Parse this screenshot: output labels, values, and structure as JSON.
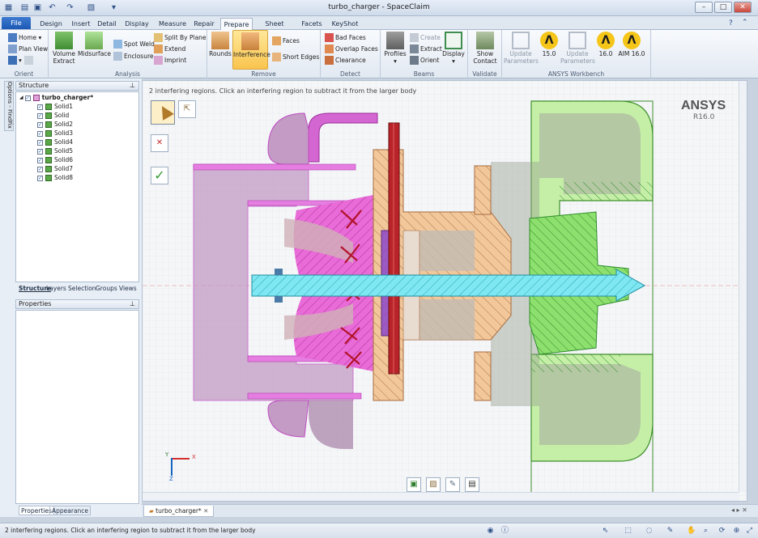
{
  "window": {
    "title": "turbo_charger - SpaceClaim"
  },
  "ribbon_tabs": [
    "File",
    "Design",
    "Insert",
    "Detail",
    "Display",
    "Measure",
    "Repair",
    "Prepare",
    "Sheet Metal",
    "Facets",
    "KeyShot"
  ],
  "active_tab": "Prepare",
  "groups": {
    "orient": {
      "label": "Orient",
      "home": "Home",
      "plan_view": "Plan View"
    },
    "analysis": {
      "label": "Analysis",
      "volume_extract": "Volume Extract",
      "midsurface": "Midsurface",
      "spot_weld": "Spot Weld",
      "enclosure": "Enclosure",
      "split_by_plane": "Split By Plane",
      "extend": "Extend",
      "imprint": "Imprint"
    },
    "remove": {
      "label": "Remove",
      "rounds": "Rounds",
      "interference": "Interference",
      "faces": "Faces",
      "short_edges": "Short Edges"
    },
    "detect": {
      "label": "Detect",
      "bad_faces": "Bad Faces",
      "overlap_faces": "Overlap Faces",
      "clearance": "Clearance"
    },
    "beams": {
      "label": "Beams",
      "profiles": "Profiles",
      "create": "Create",
      "extract": "Extract",
      "orient": "Orient",
      "display": "Display"
    },
    "validate": {
      "label": "Validate",
      "show_contact": "Show Contact"
    },
    "ansys": {
      "label": "ANSYS Workbench",
      "update_params_1": "Update Parameters",
      "v150": "15.0",
      "update_params_2": "Update Parameters",
      "v160": "16.0",
      "aim160": "AIM 16.0"
    }
  },
  "structure": {
    "header": "Structure",
    "root": "turbo_charger*",
    "items": [
      "Solid1",
      "Solid",
      "Solid2",
      "Solid3",
      "Solid4",
      "Solid5",
      "Solid6",
      "Solid7",
      "Solid8"
    ],
    "tabs": [
      "Structure",
      "Layers",
      "Selection",
      "Groups",
      "Views"
    ]
  },
  "side_tab": "Options - FindFix",
  "properties": {
    "header": "Properties",
    "tabs": [
      "Properties",
      "Appearance"
    ]
  },
  "viewport": {
    "hint": "2 interfering regions. Click an interfering region to subtract it from the larger body",
    "brand": "ANSYS",
    "version": "R16.0",
    "axis_x": "X",
    "axis_y": "Y",
    "axis_z": "Z"
  },
  "doc_tab": "turbo_charger*",
  "status": "2 interfering regions. Click an interfering region to subtract it from the larger body",
  "colors": {
    "accent": "#1d59b4",
    "pink_body": "#d44fd1",
    "shaft": "#6fe3ef",
    "orange_body": "#f5c79c",
    "green_body": "#b9e88f",
    "red_plate": "#b8242a"
  }
}
